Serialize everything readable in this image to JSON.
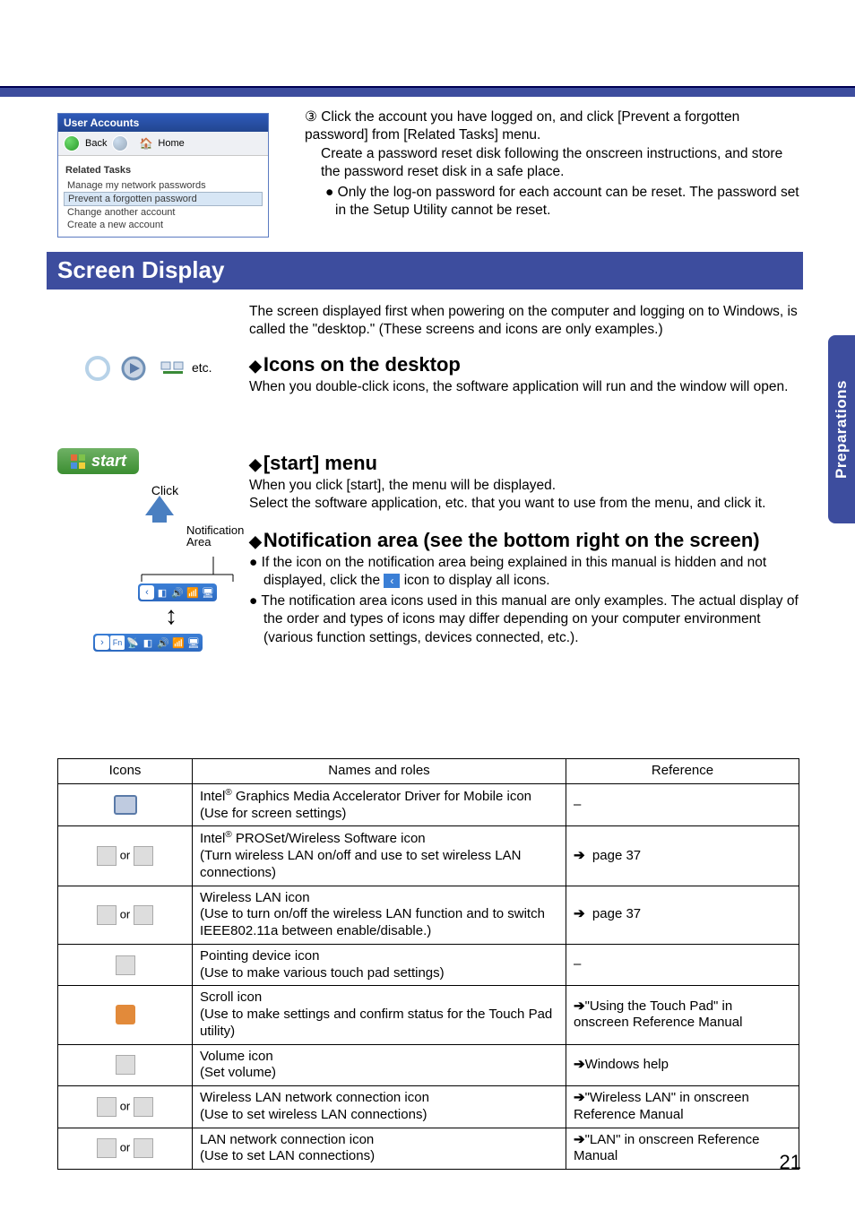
{
  "side_tab": "Preparations",
  "page_number": "21",
  "ua_window": {
    "title": "User Accounts",
    "back": "Back",
    "home": "Home",
    "related_tasks_label": "Related Tasks",
    "items": [
      "Manage my network passwords",
      "Prevent a forgotten password",
      "Change another account",
      "Create a new account"
    ]
  },
  "step3": {
    "marker": "③",
    "line1": "Click the account you have logged on, and click [Prevent a forgotten password] from [Related Tasks] menu.",
    "line2": "Create a password reset disk following the onscreen instructions, and store the password reset disk in a safe place.",
    "bullet": "Only the log-on password for each account can be reset. The password set in the Setup Utility cannot be reset."
  },
  "section_bar": "Screen Display",
  "desktop_intro": "The screen displayed first when powering on the computer and logging on to Windows, is called the \"desktop.\" (These screens and icons are only examples.)",
  "icons_fig_etc": "etc.",
  "start_fig": {
    "start_label": "start",
    "click_label": "Click",
    "notif_label": "Notification\nArea"
  },
  "h_icons": {
    "title": "Icons on the desktop",
    "body": "When you double-click icons, the software application will run and the window will open."
  },
  "h_start": {
    "title": "[start] menu",
    "body1": "When you click [start], the menu will be displayed.",
    "body2": "Select the software application, etc. that you want to use from the menu, and click it."
  },
  "h_notif": {
    "title": "Notification area (see the bottom right on the screen)",
    "b1a": "If the icon on the notification area being explained in this manual is hidden and not displayed, click the ",
    "b1b": " icon to display all icons.",
    "b2": "The notification area icons used in this manual are only examples.  The actual display of the order and types of icons may differ depending on your computer environment (various function settings, devices connected, etc.)."
  },
  "table": {
    "headers": {
      "icons": "Icons",
      "names": "Names and roles",
      "ref": "Reference"
    },
    "rows": [
      {
        "icon_html": "<span class='gray-square'></span>",
        "name": "Intel<span class='sup'>®</span> Graphics Media Accelerator Driver for Mobile icon<br>(Use for screen settings)",
        "ref": "–"
      },
      {
        "icon_html": "<span class='img-ph'></span> or <span class='img-ph'></span>",
        "name": "Intel<span class='sup'>®</span> PROSet/Wireless Software icon<br>(Turn wireless LAN on/off and use to set wireless LAN connections)",
        "ref": "<span class='arrow'>➔</span>&nbsp;&nbsp;page 37"
      },
      {
        "icon_html": "<span class='img-ph'></span> or <span class='img-ph'></span>",
        "name": "Wireless LAN icon<br>(Use to turn on/off the wireless LAN function and to switch IEEE802.11a between enable/disable.)",
        "ref": "<span class='arrow'>➔</span>&nbsp;&nbsp;page 37"
      },
      {
        "icon_html": "<span class='img-ph'></span>",
        "name": "Pointing device icon<br>(Use to make various touch pad settings)",
        "ref": "–"
      },
      {
        "icon_html": "<span class='orange-square'></span>",
        "name": "Scroll icon<br>(Use to make settings and confirm status for the Touch Pad utility)",
        "ref": "<span class='arrow'>➔</span>\"Using the Touch Pad\" in onscreen Reference Manual"
      },
      {
        "icon_html": "<span class='img-ph'></span>",
        "name": "Volume icon<br>(Set volume)",
        "ref": "<span class='arrow'>➔</span>Windows help"
      },
      {
        "icon_html": "<span class='img-ph'></span> or <span class='img-ph'></span>",
        "name": "Wireless LAN network connection icon<br>(Use to set wireless LAN connections)",
        "ref": "<span class='arrow'>➔</span>\"Wireless LAN\" in onscreen Reference Manual"
      },
      {
        "icon_html": "<span class='img-ph'></span> or <span class='img-ph'></span>",
        "name": "LAN network connection icon<br>(Use to set LAN connections)",
        "ref": "<span class='arrow'>➔</span>\"LAN\" in onscreen Reference Manual"
      }
    ]
  }
}
